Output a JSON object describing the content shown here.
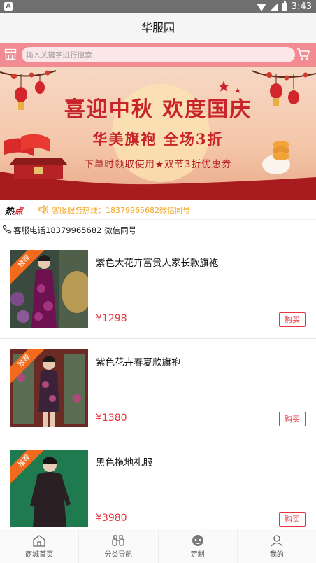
{
  "status_bar": {
    "time": "3:43",
    "left_badge": "A"
  },
  "header": {
    "title": "华服园"
  },
  "search": {
    "placeholder": "输入关键字进行搜索"
  },
  "banner": {
    "title": "喜迎中秋 欢度国庆",
    "subtitle": "华美旗袍 全场3折",
    "line": "下单时领取使用★双节3折优惠券"
  },
  "hot": {
    "label_a": "热",
    "label_b": "点",
    "text": "客服服务热线：18379965682微信同号"
  },
  "service": {
    "text": "客服电话18379965682 微信同号"
  },
  "products": [
    {
      "badge": "推荐",
      "name": "紫色大花卉富贵人家长款旗袍",
      "price": "¥1298",
      "buy_label": "购买"
    },
    {
      "badge": "推荐",
      "name": "紫色花卉春夏款旗袍",
      "price": "¥1380",
      "buy_label": "购买"
    },
    {
      "badge": "推荐",
      "name": "黑色拖地礼服",
      "price": "¥3980",
      "buy_label": "购买"
    }
  ],
  "tabs": [
    {
      "label": "商城首页",
      "icon": "home-icon"
    },
    {
      "label": "分类导航",
      "icon": "binoculars-icon"
    },
    {
      "label": "定制",
      "icon": "custom-icon"
    },
    {
      "label": "我的",
      "icon": "user-icon"
    }
  ],
  "colors": {
    "accent": "#e8343c",
    "search_bar": "#f28b92",
    "hot_text": "#f5a623",
    "ribbon": "#f26b1d"
  }
}
